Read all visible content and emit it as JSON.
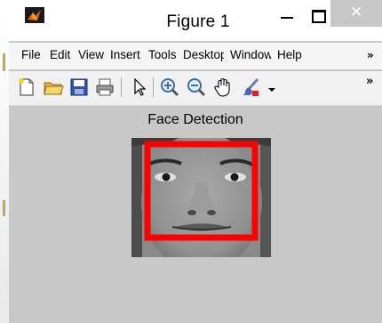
{
  "window": {
    "title": "Figure 1",
    "icon": "matlab-icon",
    "controls": [
      "minimize-icon",
      "maximize-icon",
      "close-icon"
    ]
  },
  "menubar": {
    "items": [
      "File",
      "Edit",
      "View",
      "Insert",
      "Tools",
      "Desktop",
      "Window",
      "Help"
    ],
    "overflow": "overflow-chevron-icon"
  },
  "toolbar": {
    "tools": [
      "new-figure-icon",
      "open-file-icon",
      "save-icon",
      "print-icon",
      "edit-plot-arrow-icon",
      "zoom-in-icon",
      "zoom-out-icon",
      "pan-hand-icon",
      "data-brush-icon",
      "brush-dropdown-icon"
    ],
    "overflow": "overflow-chevron-icon"
  },
  "figure": {
    "title": "Face Detection",
    "detection_box_color": "#ff0000",
    "background_color": "#c8c8c8"
  }
}
